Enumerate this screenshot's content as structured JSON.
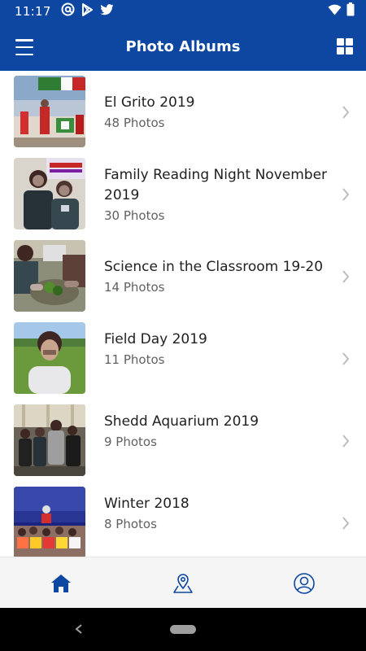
{
  "status_bar": {
    "time": "11:17",
    "left_icons": [
      "at-sign-icon",
      "play-store-icon",
      "twitter-icon"
    ],
    "right_icons": [
      "wifi-icon",
      "battery-icon"
    ]
  },
  "app_bar": {
    "title": "Photo Albums",
    "left_icon": "menu-icon",
    "right_icon": "grid-view-icon",
    "color": "#0d47a1"
  },
  "albums": [
    {
      "title": "El Grito 2019",
      "count": "48 Photos"
    },
    {
      "title": "Family Reading Night November 2019",
      "count": "30 Photos"
    },
    {
      "title": "Science in the Classroom 19-20",
      "count": "14 Photos"
    },
    {
      "title": "Field Day 2019",
      "count": "11 Photos"
    },
    {
      "title": "Shedd Aquarium 2019",
      "count": "9 Photos"
    },
    {
      "title": "Winter 2018",
      "count": "8 Photos"
    }
  ],
  "bottom_nav": {
    "items": [
      "home-icon",
      "location-map-icon",
      "profile-icon"
    ],
    "active_color": "#0d47a1"
  },
  "system_nav": [
    "back-icon",
    "home-pill"
  ]
}
